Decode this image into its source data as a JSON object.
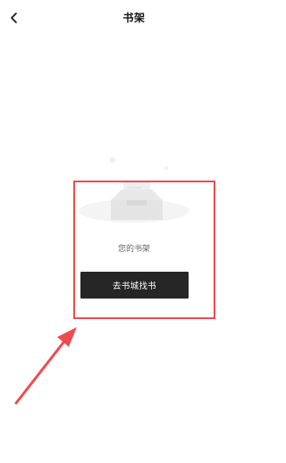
{
  "nav": {
    "back_icon": "chevron-left-icon",
    "title": "书架"
  },
  "empty_state": {
    "icon": "empty-inbox-icon",
    "label": "您的书架",
    "button_label": "去书城找书"
  },
  "annotation": {
    "color": "#ee4b4f"
  },
  "colors": {
    "background": "#ffffff",
    "button_background": "#262626",
    "button_text": "#ffffff",
    "label_text": "#666666"
  }
}
